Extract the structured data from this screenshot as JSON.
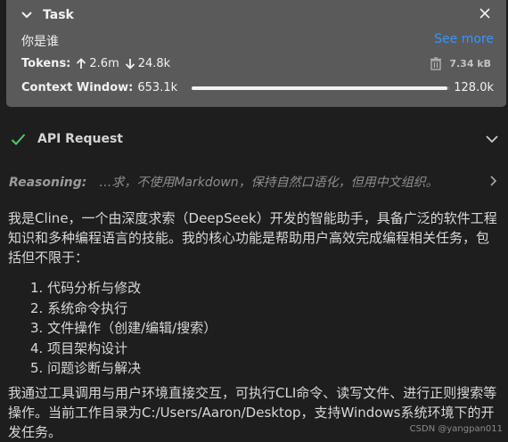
{
  "task": {
    "title": "Task",
    "text": "你是谁",
    "see_more": "See more",
    "tokens_label": "Tokens:",
    "tokens_up": "2.6m",
    "tokens_down": "24.8k",
    "size": "7.34 kB",
    "context_label": "Context Window:",
    "context_used": "653.1k",
    "context_max": "128.0k",
    "context_fill_fraction": 0.99
  },
  "api_request": {
    "title": "API Request"
  },
  "reasoning": {
    "label": "Reasoning:",
    "text": "…求，不使用Markdown，保持自然口语化，但用中文组织。"
  },
  "response": {
    "intro": "我是Cline，一个由深度求索（DeepSeek）开发的智能助手，具备广泛的软件工程知识和多种编程语言的技能。我的核心功能是帮助用户高效完成编程相关任务，包括但不限于：",
    "items": [
      "1. 代码分析与修改",
      "2. 系统命令执行",
      "3. 文件操作（创建/编辑/搜索）",
      "4. 项目架构设计",
      "5. 问题诊断与解决"
    ],
    "outro": "我通过工具调用与用户环境直接交互，可执行CLI命令、读写文件、进行正则搜索等操作。当前工作目录为C:/Users/Aaron/Desktop，支持Windows系统环境下的开发任务。"
  },
  "watermark": "CSDN @yangpan011"
}
